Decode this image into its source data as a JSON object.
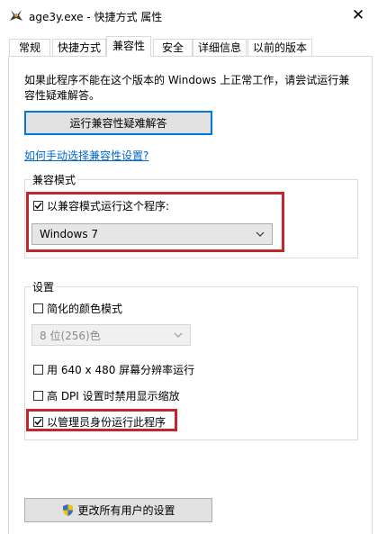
{
  "window": {
    "title": "age3y.exe - 快捷方式 属性",
    "close_glyph": "✕"
  },
  "tabs": [
    {
      "label": "常规"
    },
    {
      "label": "快捷方式"
    },
    {
      "label": "兼容性",
      "active": true
    },
    {
      "label": "安全"
    },
    {
      "label": "详细信息"
    },
    {
      "label": "以前的版本"
    }
  ],
  "intro_text": "如果此程序不能在这个版本的 Windows 上正常工作，请尝试运行兼容性疑难解答。",
  "troubleshooter_button": "运行兼容性疑难解答",
  "manual_link": "如何手动选择兼容性设置?",
  "compat_mode": {
    "group_label": "兼容模式",
    "checkbox_label": "以兼容模式运行这个程序:",
    "checked": true,
    "os_selected": "Windows 7"
  },
  "settings": {
    "group_label": "设置",
    "reduced_color": {
      "label": "简化的颜色模式",
      "checked": false
    },
    "color_select": "8 位(256)色",
    "res_640": {
      "label": "用 640 x 480 屏幕分辨率运行",
      "checked": false
    },
    "high_dpi": {
      "label": "高 DPI 设置时禁用显示缩放",
      "checked": false
    },
    "run_admin": {
      "label": "以管理员身份运行此程序",
      "checked": true
    }
  },
  "all_users_button": "更改所有用户的设置",
  "colors": {
    "highlight": "#c1272d",
    "link": "#0066cc",
    "focus": "#0078d7"
  }
}
